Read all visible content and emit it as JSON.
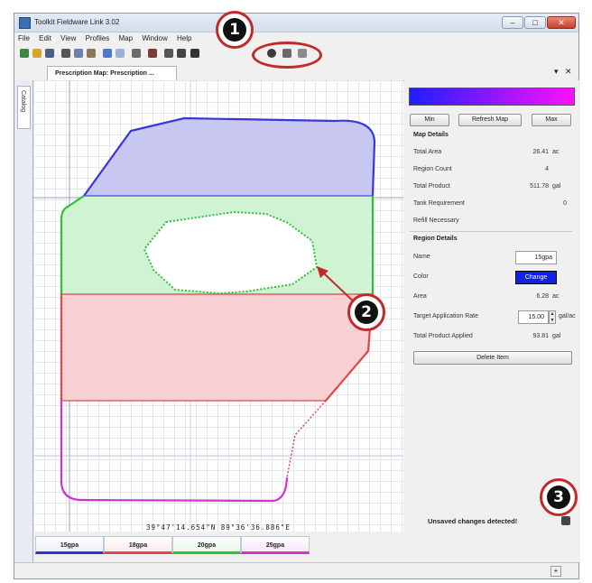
{
  "window": {
    "title": "Toolkit Fieldware Link 3.02"
  },
  "menu": [
    "File",
    "Edit",
    "View",
    "Profiles",
    "Map",
    "Window",
    "Help"
  ],
  "tab": {
    "label": "Prescription Map: Prescription ..."
  },
  "side_tab": {
    "label": "Catalog"
  },
  "panel": {
    "buttons": {
      "min": "Min",
      "refresh": "Refresh Map",
      "max": "Max"
    },
    "map_details": {
      "heading": "Map Details",
      "rows": [
        {
          "label": "Total Area",
          "value": "26.41",
          "unit": "ac"
        },
        {
          "label": "Region Count",
          "value": "4",
          "unit": ""
        },
        {
          "label": "Total Product",
          "value": "511.78",
          "unit": "gal"
        },
        {
          "label": "Tank Requirement",
          "value": "0",
          "unit": ""
        },
        {
          "label": "Refill Necessary",
          "value": "",
          "unit": ""
        }
      ]
    },
    "region_details": {
      "heading": "Region Details",
      "name_label": "Name",
      "name_value": "15gpa",
      "color_label": "Color",
      "color_button": "Change",
      "area_label": "Area",
      "area_value": "6.28",
      "area_unit": "ac",
      "rate_label": "Target Application Rate",
      "rate_value": "15.00",
      "rate_unit": "gal/ac",
      "product_label": "Total Product Applied",
      "product_value": "93.81",
      "product_unit": "gal",
      "delete_button": "Delete Item"
    }
  },
  "coordinates": "39°47'14.654\"N 89°36'36.886\"E",
  "status": {
    "unsaved": "Unsaved changes detected!"
  },
  "legend": [
    {
      "label": "15gpa",
      "color": "#3333cc"
    },
    {
      "label": "18gpa",
      "color": "#e04848"
    },
    {
      "label": "20gpa",
      "color": "#2fbf3a"
    },
    {
      "label": "25gpa",
      "color": "#d033d0"
    }
  ],
  "callouts": [
    "1",
    "2",
    "3"
  ],
  "colors": {
    "blue_zone": "#c7c7f2",
    "green_zone": "#cff3d3",
    "red_zone": "#f8cfd2",
    "accent_red": "#c22a2a"
  }
}
